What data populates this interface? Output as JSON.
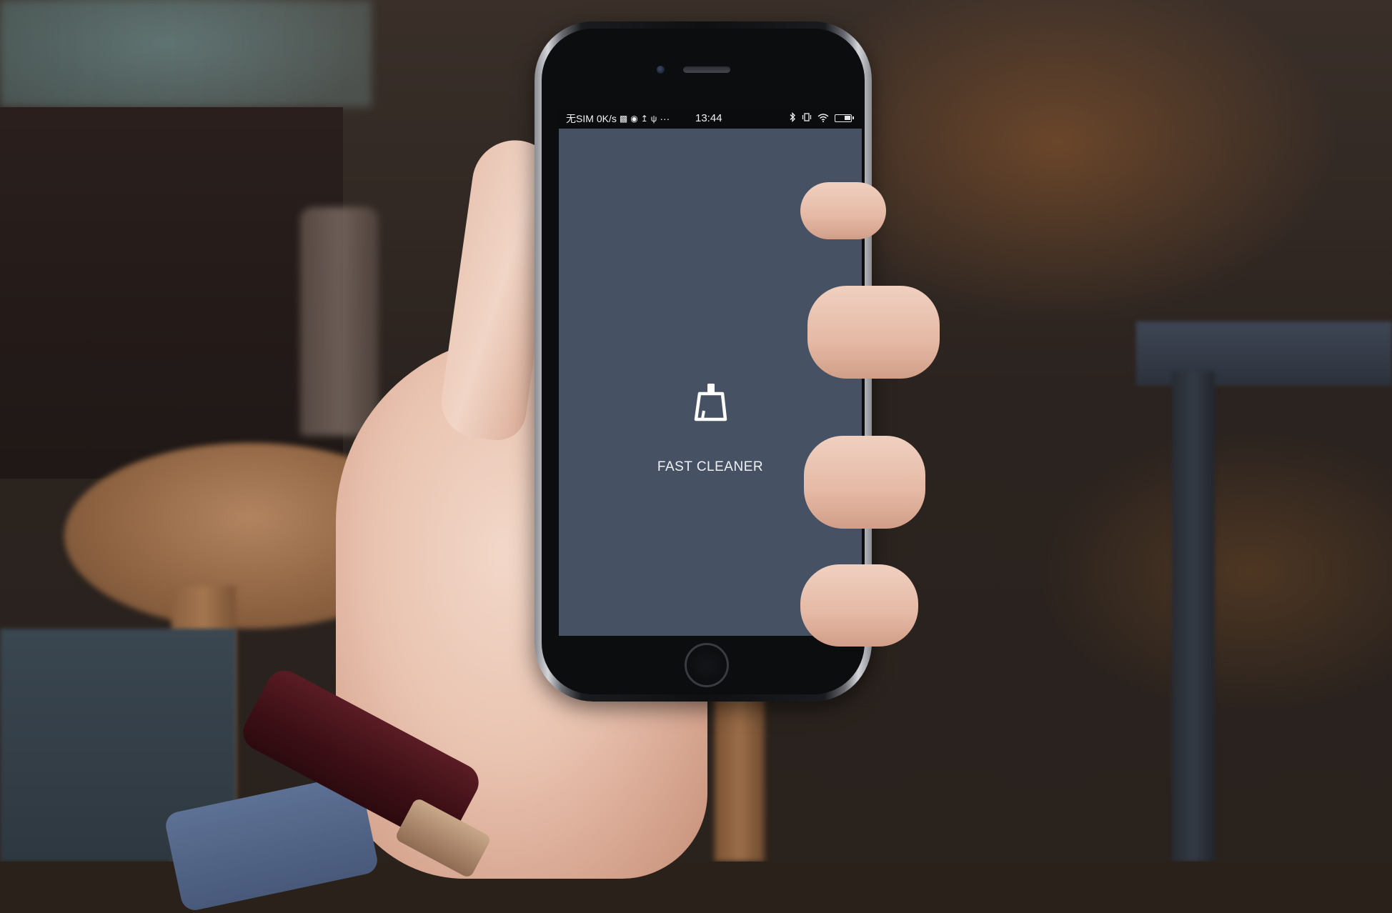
{
  "status_bar": {
    "carrier": "无SIM",
    "network_speed": "0K/s",
    "time": "13:44",
    "overflow": "···"
  },
  "app": {
    "title": "FAST CLEANER",
    "icon": "broom-icon"
  },
  "colors": {
    "screen_background": "#465264",
    "status_bar_background": "#0b0c0e",
    "text": "#eef1f5"
  }
}
